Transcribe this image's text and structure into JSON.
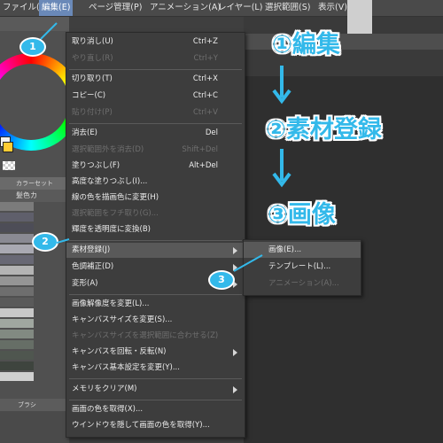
{
  "menubar": {
    "items": [
      {
        "label": "ファイル(F)",
        "active": false
      },
      {
        "label": "編集(E)",
        "active": true
      },
      {
        "label": "ページ管理(P)",
        "active": false
      },
      {
        "label": "アニメーション(A)",
        "active": false
      },
      {
        "label": "レイヤー(L)",
        "active": false
      },
      {
        "label": "選択範囲(S)",
        "active": false
      },
      {
        "label": "表示(V)",
        "active": false
      }
    ]
  },
  "left_panel": {
    "colorset_tab": "カラーセット",
    "colorset_label": "髪色カ",
    "brush_tab": "ブラシ"
  },
  "edit_menu": {
    "items": [
      {
        "label": "取り消し(U)",
        "shortcut": "Ctrl+Z",
        "disabled": false
      },
      {
        "label": "やり直し(R)",
        "shortcut": "Ctrl+Y",
        "disabled": true
      },
      {
        "label": "切り取り(T)",
        "shortcut": "Ctrl+X",
        "disabled": false
      },
      {
        "label": "コピー(C)",
        "shortcut": "Ctrl+C",
        "disabled": false
      },
      {
        "label": "貼り付け(P)",
        "shortcut": "Ctrl+V",
        "disabled": true
      },
      {
        "label": "消去(E)",
        "shortcut": "Del",
        "disabled": false
      },
      {
        "label": "選択範囲外を消去(D)",
        "shortcut": "Shift+Del",
        "disabled": true
      },
      {
        "label": "塗りつぶし(F)",
        "shortcut": "Alt+Del",
        "disabled": false
      },
      {
        "label": "高度な塗りつぶし(I)...",
        "shortcut": "",
        "disabled": false
      },
      {
        "label": "線の色を描画色に変更(H)",
        "shortcut": "",
        "disabled": false
      },
      {
        "label": "選択範囲をフチ取り(G)...",
        "shortcut": "",
        "disabled": true
      },
      {
        "label": "輝度を透明度に変換(B)",
        "shortcut": "",
        "disabled": false
      },
      {
        "label": "素材登録(J)",
        "shortcut": "",
        "disabled": false,
        "submenu": true
      },
      {
        "label": "色調補正(D)",
        "shortcut": "",
        "disabled": false,
        "submenu": true
      },
      {
        "label": "変形(A)",
        "shortcut": "",
        "disabled": false,
        "submenu": true
      },
      {
        "label": "画像解像度を変更(L)...",
        "shortcut": "",
        "disabled": false
      },
      {
        "label": "キャンバスサイズを変更(S)...",
        "shortcut": "",
        "disabled": false
      },
      {
        "label": "キャンバスサイズを選択範囲に合わせる(Z)",
        "shortcut": "",
        "disabled": true
      },
      {
        "label": "キャンバスを回転・反転(N)",
        "shortcut": "",
        "disabled": false,
        "submenu": true
      },
      {
        "label": "キャンバス基本設定を変更(Y)...",
        "shortcut": "",
        "disabled": false
      },
      {
        "label": "メモリをクリア(M)",
        "shortcut": "",
        "disabled": false,
        "submenu": true
      },
      {
        "label": "画面の色を取得(X)...",
        "shortcut": "",
        "disabled": false
      },
      {
        "label": "ウインドウを隠して画面の色を取得(Y)...",
        "shortcut": "",
        "disabled": false
      }
    ]
  },
  "sub_menu": {
    "items": [
      {
        "label": "画像(E)...",
        "disabled": false
      },
      {
        "label": "テンプレート(L)...",
        "disabled": false
      },
      {
        "label": "アニメーション(A)...",
        "disabled": true
      }
    ]
  },
  "annotations": {
    "step1": "①編集",
    "step2": "②素材登録",
    "step3": "③画像",
    "badge1": "1",
    "badge2": "2",
    "badge3": "3",
    "accent_color": "#33b9ea"
  }
}
